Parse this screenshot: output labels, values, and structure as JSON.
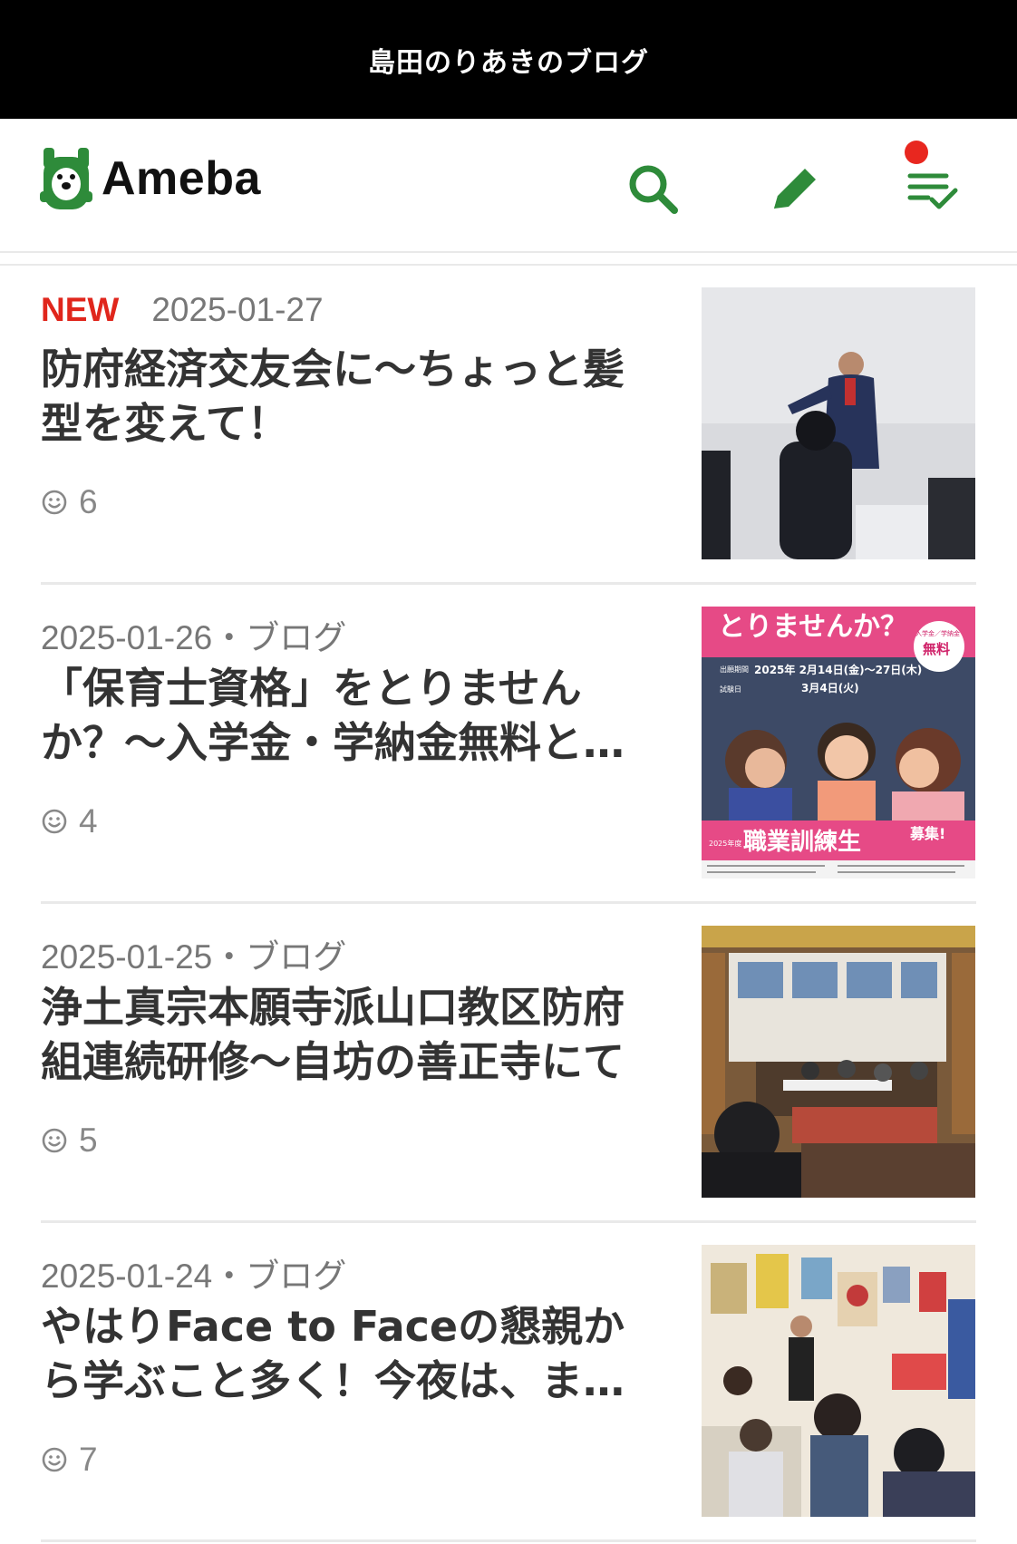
{
  "blog_title": "島田のりあきのブログ",
  "header": {
    "logo_text": "Ameba",
    "icons": [
      "search-icon",
      "pencil-icon",
      "checklist-icon"
    ],
    "accent_color": "#2e8b3a",
    "notification_color": "#e8271f"
  },
  "entries": [
    {
      "badge": "NEW",
      "date": "2025-01-27",
      "title": "防府経済交友会に〜ちょっと髪型を変えて！",
      "likes": "6"
    },
    {
      "date": "2025-01-26・ブログ",
      "title": "「保育士資格」をとりませんか？〜入学金・学納金無料と…",
      "likes": "4",
      "thumb_text": {
        "headline": "とりませんか？",
        "free": "無料",
        "free_note": "入学金／学納金",
        "date1": "2025年 2月14日(金)〜27日(木)",
        "date2": "3月4日(火)",
        "label1": "出願期間",
        "label2": "試験日",
        "bottom": "職業訓練生",
        "bottom_year": "2025年度",
        "recruit": "募集!"
      }
    },
    {
      "date": "2025-01-25・ブログ",
      "title": "浄土真宗本願寺派山口教区防府組連続研修〜自坊の善正寺にて",
      "likes": "5"
    },
    {
      "date": "2025-01-24・ブログ",
      "title": "やはりFace to Faceの懇親から学ぶこと多く！今夜は、ま…",
      "likes": "7"
    }
  ]
}
